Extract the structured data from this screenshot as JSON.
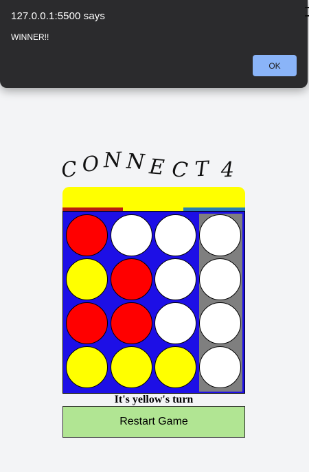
{
  "dialog": {
    "origin": "127.0.0.1:5500 says",
    "message": "WINNER!!",
    "ok_label": "OK"
  },
  "game": {
    "title_letters": [
      "C",
      "O",
      "N",
      "N",
      "E",
      "C",
      "T",
      "4"
    ],
    "hover_piece_color": "yellow",
    "highlighted_column": 4,
    "stripe_colors": [
      "#b91e10",
      "#ffff00",
      "#2a7fb2"
    ],
    "colors": {
      "red": "#ff0000",
      "yellow": "#ffff00",
      "empty": "#ffffff",
      "board": "#1d0fe6",
      "highlight": "#7f7f7f"
    },
    "board": [
      [
        "red",
        "empty",
        "empty",
        "empty"
      ],
      [
        "yellow",
        "red",
        "empty",
        "empty"
      ],
      [
        "red",
        "red",
        "empty",
        "empty"
      ],
      [
        "yellow",
        "yellow",
        "yellow",
        "empty"
      ]
    ],
    "turn_text": "It's yellow's turn",
    "restart_label": "Restart Game"
  }
}
